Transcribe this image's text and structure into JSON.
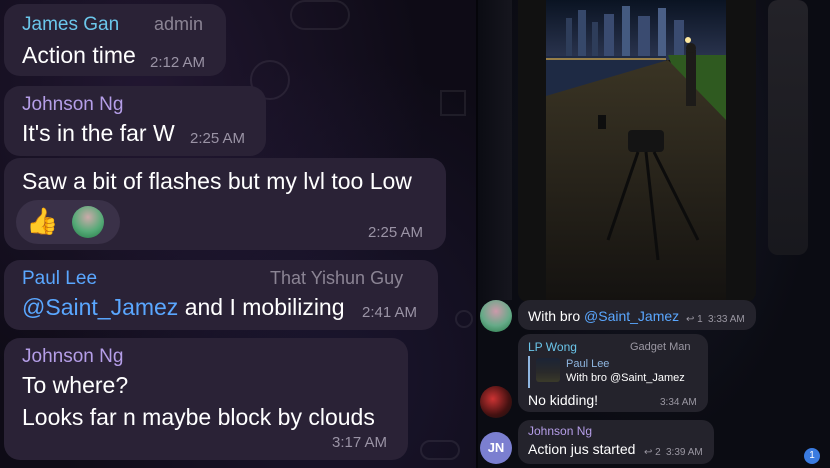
{
  "left_messages": [
    {
      "sender": "James Gan",
      "role": "admin",
      "text": "Action time",
      "time": "2:12 AM",
      "name_color": "#6bc6ea"
    },
    {
      "sender": "Johnson Ng",
      "text": "It's in the far W",
      "time": "2:25 AM",
      "name_color": "#b59ee8"
    },
    {
      "text": "Saw a bit of flashes but my lvl too Low",
      "time": "2:25 AM",
      "reaction_icon": "thumbs-up-icon",
      "reaction_emoji": "👍"
    },
    {
      "sender": "Paul Lee",
      "role": "That Yishun Guy",
      "mention": "@Saint_Jamez",
      "text": " and I mobilizing",
      "time": "2:41 AM",
      "name_color": "#5aa7ff"
    },
    {
      "sender": "Johnson Ng",
      "line1": "To where?",
      "line2": "Looks far n maybe block by clouds",
      "time": "3:17 AM",
      "name_color": "#b59ee8"
    }
  ],
  "right_messages": [
    {
      "text": "With bro ",
      "mention": "@Saint_Jamez",
      "reply_count": "1",
      "time": "3:33 AM"
    },
    {
      "sender": "LP Wong",
      "role": "Gadget Man",
      "quote_sender": "Paul Lee",
      "quote_text": "With bro @Saint_Jamez",
      "text": "No kidding!",
      "time": "3:34 AM",
      "name_color": "#6bc6ea"
    },
    {
      "sender": "Johnson Ng",
      "text": "Action jus started",
      "reply_count": "2",
      "time": "3:39 AM",
      "avatar_initials": "JN",
      "name_color": "#b59ee8"
    }
  ],
  "unread_badge": "1",
  "photo_icon": "night-city-photo",
  "colors": {
    "accent": "#5aa7ff",
    "bubble": "#2a2236",
    "avatar_jn": "#7b7fd0"
  }
}
